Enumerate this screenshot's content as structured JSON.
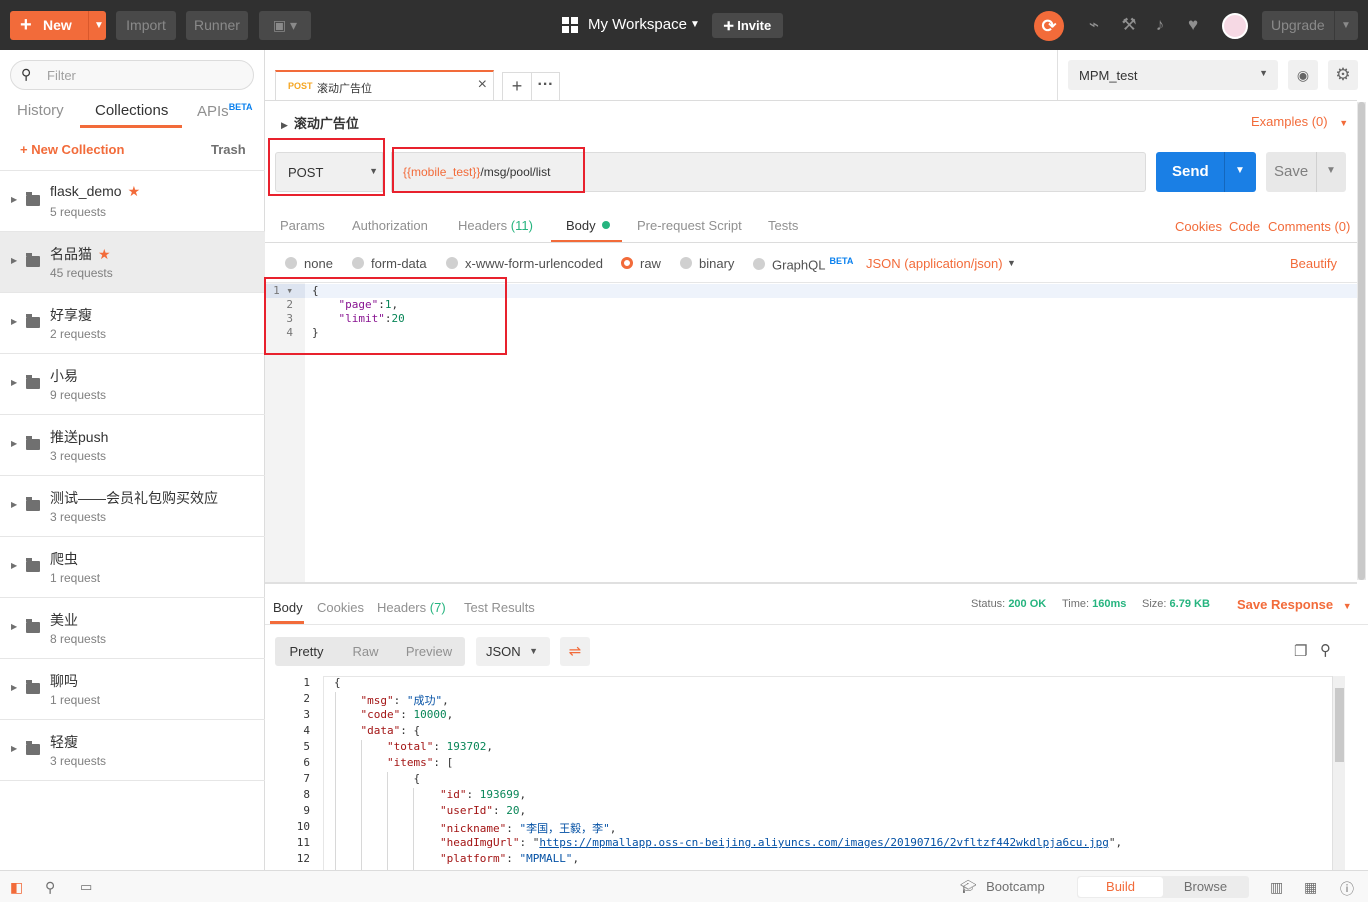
{
  "topbar": {
    "new_label": "New",
    "import_label": "Import",
    "runner_label": "Runner",
    "workspace_label": "My Workspace",
    "invite_label": "Invite",
    "upgrade_label": "Upgrade"
  },
  "sidebar": {
    "filter_placeholder": "Filter",
    "tabs": {
      "history": "History",
      "collections": "Collections",
      "apis": "APIs",
      "apis_badge": "BETA"
    },
    "new_collection": "New Collection",
    "trash": "Trash",
    "collections": [
      {
        "name": "flask_demo",
        "count": "5 requests",
        "starred": true
      },
      {
        "name": "名品猫",
        "count": "45 requests",
        "starred": true
      },
      {
        "name": "好享瘦",
        "count": "2 requests",
        "starred": false
      },
      {
        "name": "小易",
        "count": "9 requests",
        "starred": false
      },
      {
        "name": "推送push",
        "count": "3 requests",
        "starred": false
      },
      {
        "name": "测试——会员礼包购买效应",
        "count": "3 requests",
        "starred": false
      },
      {
        "name": "爬虫",
        "count": "1 request",
        "starred": false
      },
      {
        "name": "美业",
        "count": "8 requests",
        "starred": false
      },
      {
        "name": "聊吗",
        "count": "1 request",
        "starred": false
      },
      {
        "name": "轻瘦",
        "count": "3 requests",
        "starred": false
      }
    ]
  },
  "request_tab": {
    "method": "POST",
    "name": "滚动广告位"
  },
  "environment": {
    "selected": "MPM_test"
  },
  "request": {
    "title": "滚动广告位",
    "examples": "Examples (0)",
    "method": "POST",
    "url_var": "{{mobile_test}}",
    "url_path": "/msg/pool/list",
    "send": "Send",
    "save": "Save"
  },
  "request_tabs": {
    "params": "Params",
    "authorization": "Authorization",
    "headers": "Headers",
    "headers_count": "(11)",
    "body": "Body",
    "prerequest": "Pre-request Script",
    "tests": "Tests",
    "cookies": "Cookies",
    "code": "Code",
    "comments": "Comments (0)"
  },
  "body_modes": {
    "none": "none",
    "form_data": "form-data",
    "urlencoded": "x-www-form-urlencoded",
    "raw": "raw",
    "binary": "binary",
    "graphql": "GraphQL",
    "graphql_badge": "BETA",
    "selected": "raw",
    "content_type": "JSON (application/json)",
    "beautify": "Beautify"
  },
  "request_body": {
    "line_numbers": [
      "1",
      "2",
      "3",
      "4"
    ],
    "l1": "{",
    "k_page": "\"page\"",
    "v_page": "1",
    "k_limit": "\"limit\"",
    "v_limit": "20",
    "l4": "}"
  },
  "response_tabs": {
    "body": "Body",
    "cookies": "Cookies",
    "headers": "Headers",
    "headers_count": "(7)",
    "test_results": "Test Results"
  },
  "response_meta": {
    "status_label": "Status:",
    "status": "200 OK",
    "time_label": "Time:",
    "time": "160ms",
    "size_label": "Size:",
    "size": "6.79 KB",
    "save_response": "Save Response"
  },
  "response_view": {
    "pretty": "Pretty",
    "raw": "Raw",
    "preview": "Preview",
    "format": "JSON"
  },
  "response_body": {
    "line_numbers": [
      "1",
      "2",
      "3",
      "4",
      "5",
      "6",
      "7",
      "8",
      "9",
      "10",
      "11",
      "12"
    ],
    "k_msg": "\"msg\"",
    "v_msg": "\"成功\"",
    "k_code": "\"code\"",
    "v_code": "10000",
    "k_data": "\"data\"",
    "k_total": "\"total\"",
    "v_total": "193702",
    "k_items": "\"items\"",
    "k_id": "\"id\"",
    "v_id": "193699",
    "k_userId": "\"userId\"",
    "v_userId": "20",
    "k_nickname": "\"nickname\"",
    "v_nickname": "\"李国，王毅，李\"",
    "k_head": "\"headImgUrl\"",
    "v_head": "https://mpmallapp.oss-cn-beijing.aliyuncs.com/images/20190716/2vfltzf442wkdlpja6cu.jpg",
    "k_platform": "\"platform\"",
    "v_platform": "\"MPMALL\""
  },
  "statusbar": {
    "bootcamp": "Bootcamp",
    "build": "Build",
    "browse": "Browse"
  },
  "colors": {
    "accent": "#f26b3a",
    "send": "#1a7fe5",
    "status_ok": "#26b47f",
    "highlight_box": "#e8212d"
  }
}
